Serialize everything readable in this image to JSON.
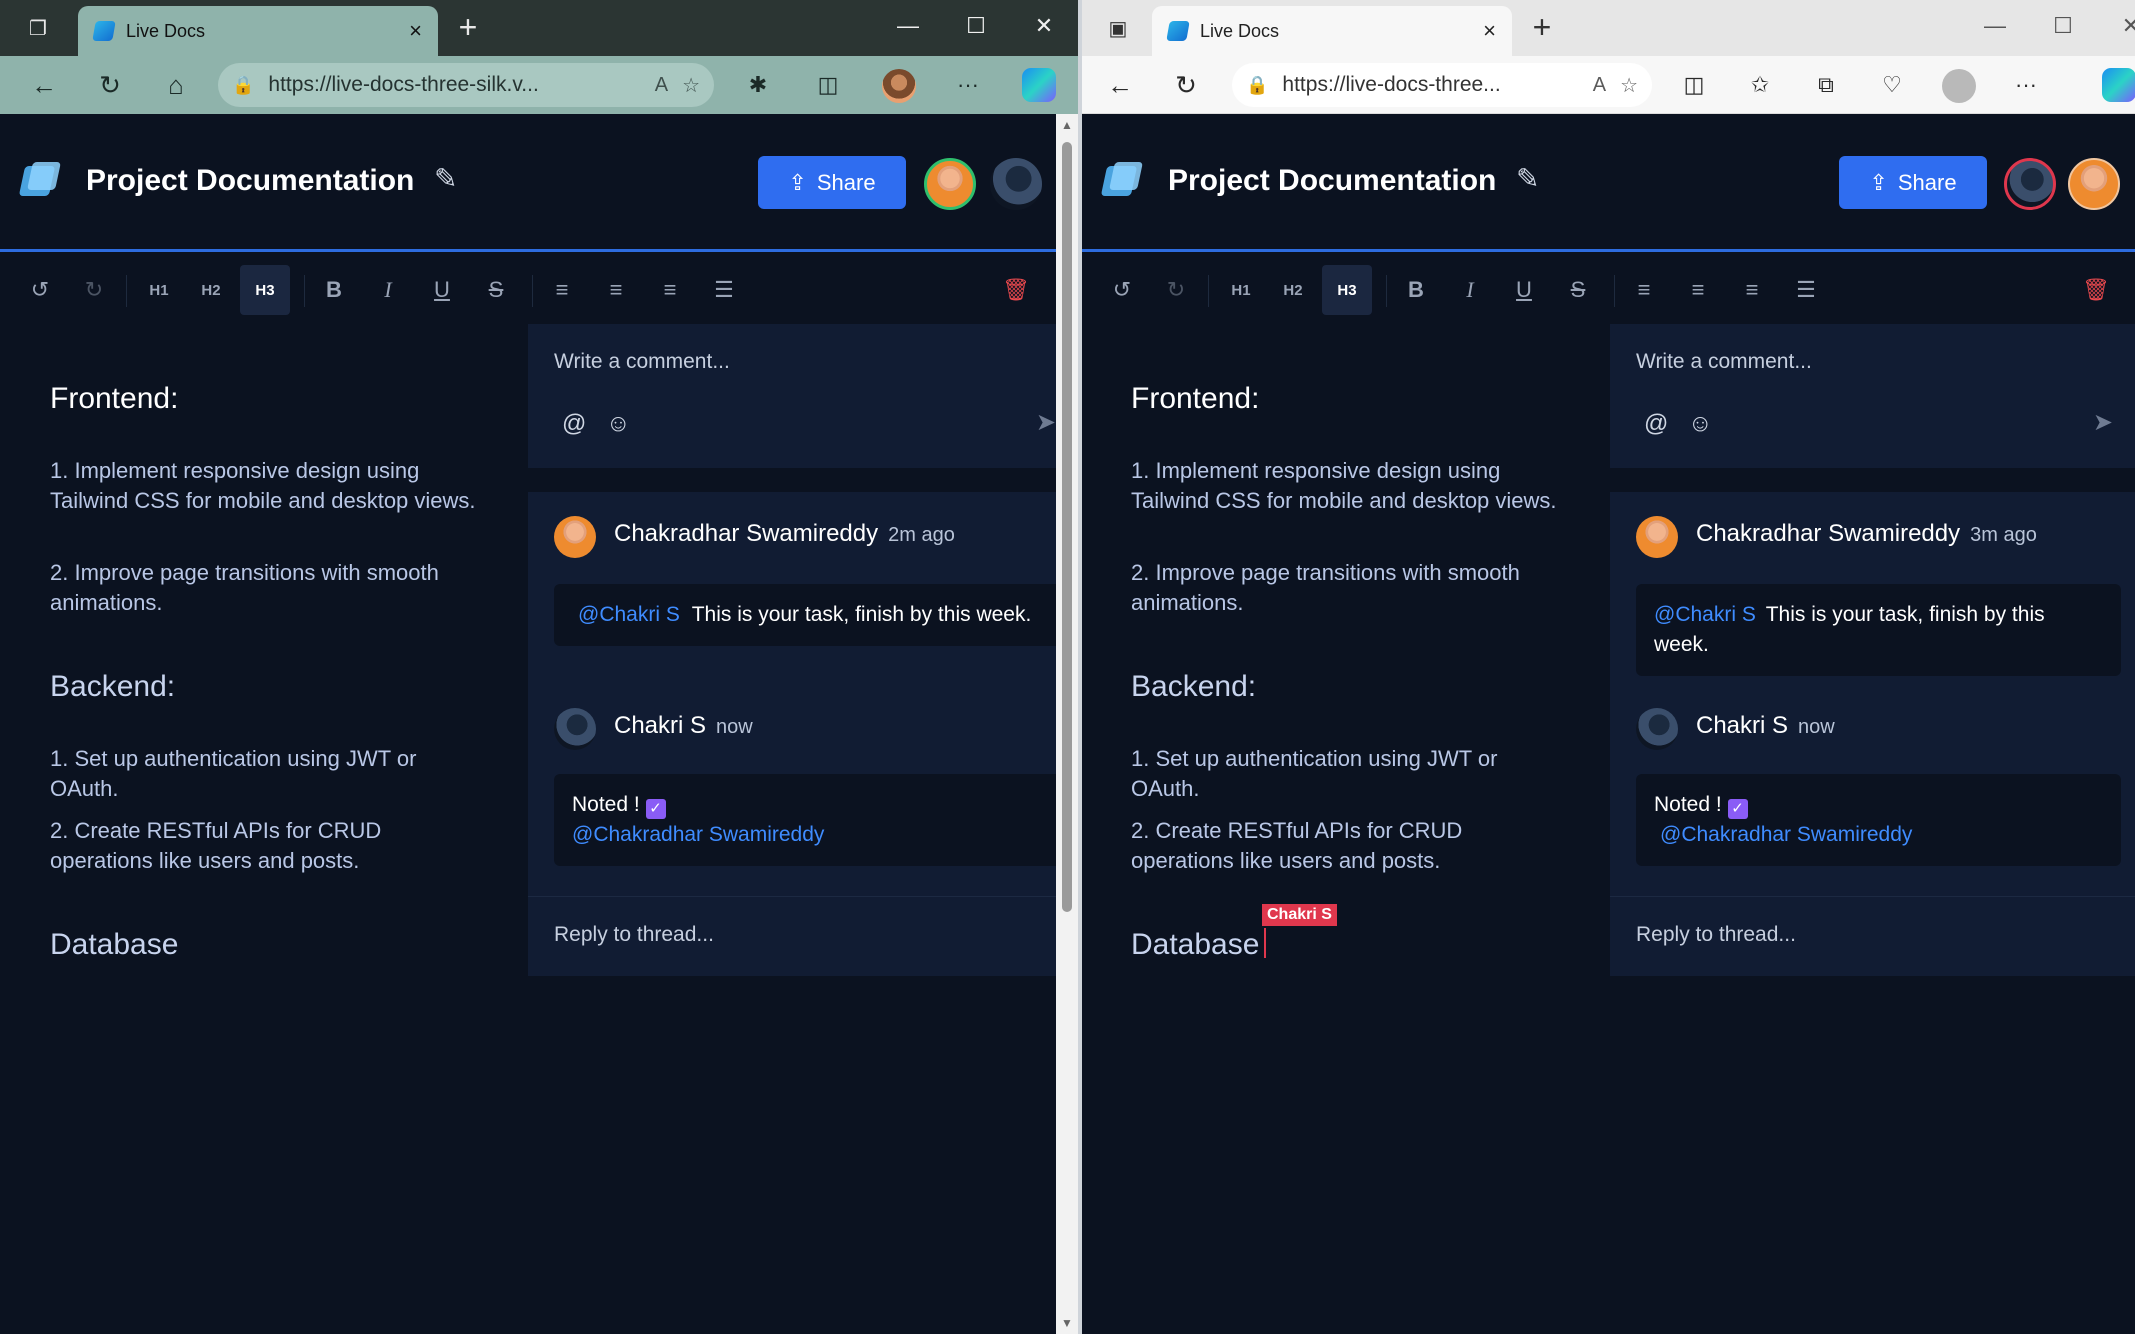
{
  "windows": [
    {
      "tab_title": "Live Docs",
      "url": "https://live-docs-three-silk.v...",
      "doc_title": "Project Documentation",
      "share_label": "Share",
      "toolbar": {
        "h1": "H1",
        "h2": "H2",
        "h3": "H3"
      },
      "editor": {
        "frontend_heading": "Frontend:",
        "frontend_item1": "1. Implement responsive design using Tailwind CSS for mobile and desktop views.",
        "frontend_item2": "2. Improve page transitions with smooth animations.",
        "backend_heading": "Backend:",
        "backend_item1": "1. Set up authentication using JWT or OAuth.",
        "backend_item2": "2. Create RESTful APIs for CRUD operations like users and posts.",
        "database_heading": "Database"
      },
      "comments": {
        "placeholder": "Write a comment...",
        "c1_author": "Chakradhar Swamireddy",
        "c1_time": "2m ago",
        "c1_mention": "@Chakri S",
        "c1_text": "This is your task, finish by this week.",
        "c2_author": "Chakri S",
        "c2_time": "now",
        "c2_text": "Noted !",
        "c2_mention": "@Chakradhar Swamireddy",
        "reply_placeholder": "Reply to thread..."
      }
    },
    {
      "tab_title": "Live Docs",
      "url": "https://live-docs-three...",
      "doc_title": "Project Documentation",
      "share_label": "Share",
      "toolbar": {
        "h1": "H1",
        "h2": "H2",
        "h3": "H3"
      },
      "editor": {
        "frontend_heading": "Frontend:",
        "frontend_item1": "1. Implement responsive design using Tailwind CSS for mobile and desktop views.",
        "frontend_item2": "2. Improve page transitions with smooth animations.",
        "backend_heading": "Backend:",
        "backend_item1": "1. Set up authentication using JWT or OAuth.",
        "backend_item2": "2. Create RESTful APIs for CRUD operations like users and posts.",
        "database_heading": "Database",
        "remote_cursor_label": "Chakri S"
      },
      "comments": {
        "placeholder": "Write a comment...",
        "c1_author": "Chakradhar Swamireddy",
        "c1_time": "3m ago",
        "c1_mention": "@Chakri S",
        "c1_text": "This is your task, finish by this week.",
        "c2_author": "Chakri S",
        "c2_time": "now",
        "c2_text": "Noted !",
        "c2_mention": "@Chakradhar Swamireddy",
        "reply_placeholder": "Reply to thread..."
      }
    }
  ],
  "colors": {
    "accent": "#2f6df0",
    "mention": "#3f8cff",
    "danger": "#e5484d",
    "app_bg": "#0b1220",
    "panel_bg": "#111c33"
  },
  "icons": [
    "tabs-icon",
    "favicon-icon",
    "close-icon",
    "plus-icon",
    "minimize-icon",
    "maximize-icon",
    "back-icon",
    "refresh-icon",
    "home-icon",
    "lock-icon",
    "read-aloud-icon",
    "star-icon",
    "extensions-icon",
    "split-screen-icon",
    "favorites-icon",
    "collections-icon",
    "health-icon",
    "more-icon",
    "copilot-icon",
    "edit-icon",
    "share-icon",
    "undo-icon",
    "redo-icon",
    "bold-icon",
    "italic-icon",
    "underline-icon",
    "strikethrough-icon",
    "align-left-icon",
    "align-center-icon",
    "align-right-icon",
    "align-justify-icon",
    "trash-icon",
    "at-icon",
    "emoji-icon",
    "send-icon",
    "checkbox-icon"
  ]
}
